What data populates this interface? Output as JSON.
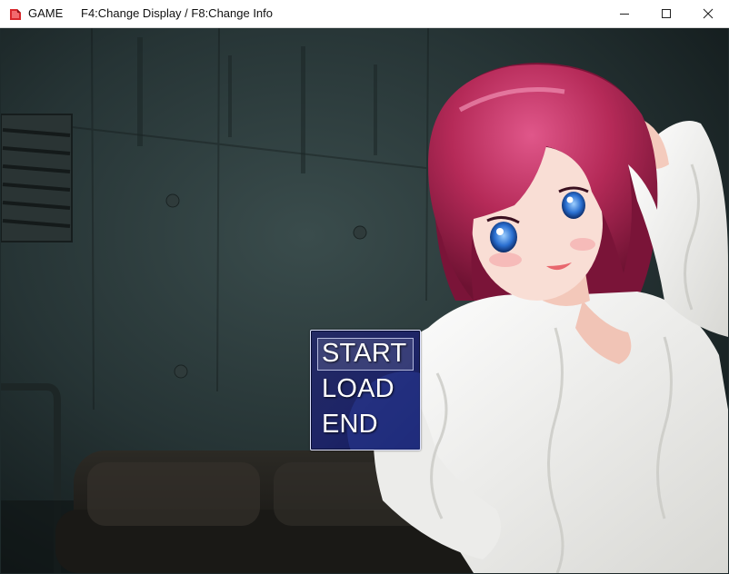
{
  "window": {
    "app_title": "GAME",
    "hint": "F4:Change Display / F8:Change Info",
    "icon": "rpg-maker-icon",
    "controls": {
      "minimize_icon": "minimize-icon",
      "maximize_icon": "maximize-icon",
      "close_icon": "close-icon"
    }
  },
  "menu": {
    "items": [
      {
        "label": "START",
        "selected": true
      },
      {
        "label": "LOAD",
        "selected": false
      },
      {
        "label": "END",
        "selected": false
      }
    ],
    "colors": {
      "background": "#1d2466",
      "border": "#dfe3ff",
      "text": "#ffffff"
    }
  },
  "scene": {
    "background": "dark-concrete-room-with-couch",
    "character": "red-haired-anime-girl-white-sweater",
    "colors": {
      "wall": "#2b3a3b",
      "hair": "#b32a55",
      "sweater": "#f1f1ef"
    }
  }
}
